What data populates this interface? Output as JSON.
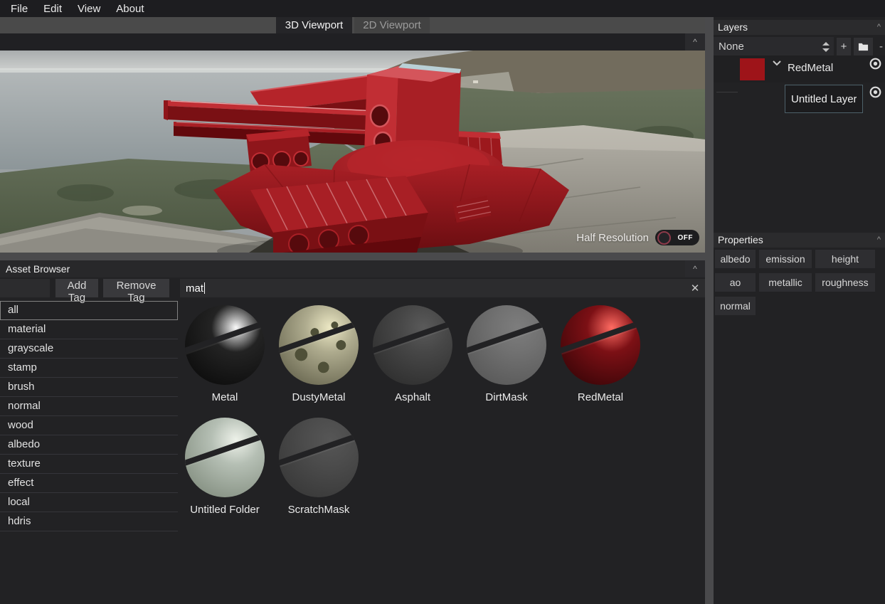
{
  "menu": {
    "items": [
      "File",
      "Edit",
      "View",
      "About"
    ]
  },
  "tabs": [
    {
      "label": "3D Viewport",
      "active": true
    },
    {
      "label": "2D Viewport",
      "active": false
    }
  ],
  "viewport": {
    "half_resolution_label": "Half Resolution",
    "half_resolution_state": "OFF"
  },
  "layers_panel": {
    "title": "Layers",
    "selected_option": "None",
    "add_label": "+",
    "remove_label": "-",
    "layers": [
      {
        "name": "RedMetal",
        "swatch_color": "#9e1419",
        "visible": true
      },
      {
        "name": "Untitled Layer",
        "visible": true,
        "renaming": true
      }
    ]
  },
  "properties_panel": {
    "title": "Properties",
    "channels": [
      "albedo",
      "emission",
      "height",
      "ao",
      "metallic",
      "roughness",
      "normal"
    ]
  },
  "asset_browser": {
    "title": "Asset Browser",
    "add_tag_label": "Add Tag",
    "remove_tag_label": "Remove Tag",
    "search_value": "mat",
    "clear_icon": "✕",
    "tags": [
      "all",
      "material",
      "grayscale",
      "stamp",
      "brush",
      "normal",
      "wood",
      "albedo",
      "texture",
      "effect",
      "local",
      "hdris"
    ],
    "selected_tag": "all",
    "assets": [
      {
        "name": "Metal",
        "base": "#232323",
        "dark": "#0e0e0e",
        "highlight": "#fafafa"
      },
      {
        "name": "DustyMetal",
        "base": "#aeab8e",
        "dark": "#6e6c55",
        "highlight": "#ece8c4",
        "dots": "#4f5038"
      },
      {
        "name": "Asphalt",
        "base": "#474747",
        "dark": "#303030",
        "highlight": "#5a5a5a"
      },
      {
        "name": "DirtMask",
        "base": "#717171",
        "dark": "#5a5a5a",
        "highlight": "#7d7d7d"
      },
      {
        "name": "RedMetal",
        "base": "#7c1015",
        "dark": "#400609",
        "highlight": "#ff6b62"
      },
      {
        "name": "Untitled Folder",
        "base": "#b5bfb4",
        "dark": "#879284",
        "highlight": "#eef2ea"
      },
      {
        "name": "ScratchMask",
        "base": "#4c4c4c",
        "dark": "#3a3a3a",
        "highlight": "#565656"
      }
    ]
  },
  "icons": {
    "collapse": "^"
  }
}
